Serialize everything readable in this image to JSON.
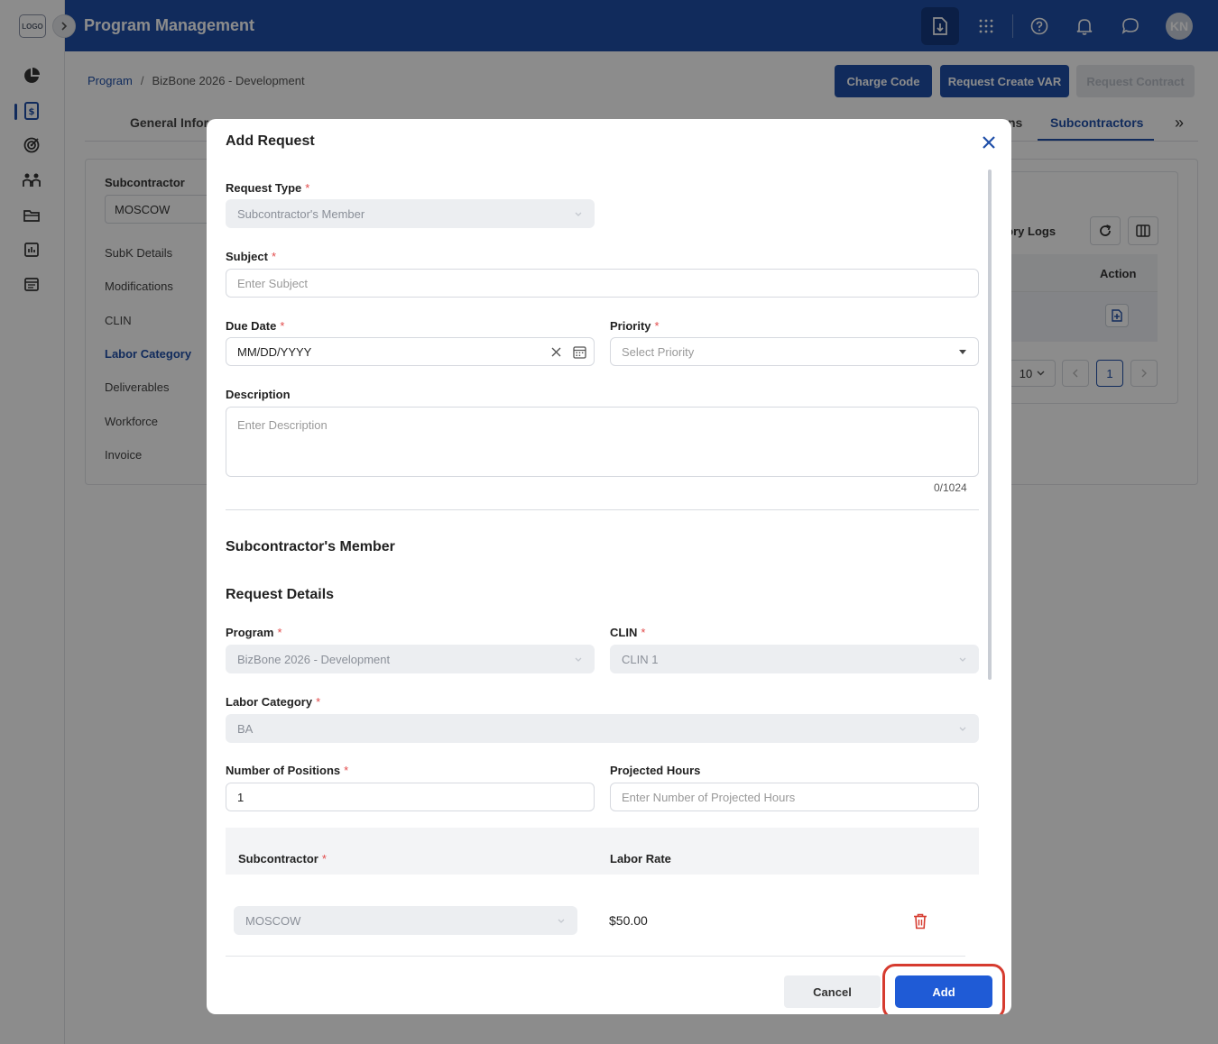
{
  "app": {
    "logo_text": "LOGO",
    "title": "Program Management",
    "avatar_initials": "KN"
  },
  "breadcrumb": {
    "root": "Program",
    "separator": "/",
    "current": "BizBone 2026 - Development"
  },
  "top_actions": {
    "charge_code": "Charge Code",
    "request_create_var": "Request Create VAR",
    "request_contract": "Request Contract"
  },
  "tabs": {
    "first": "General Infor",
    "partial": "ns",
    "active": "Subcontractors",
    "more": "»"
  },
  "side_panel": {
    "subcontractor_label": "Subcontractor",
    "subcontractor_value": "MOSCOW",
    "items": [
      "SubK Details",
      "Modifications",
      "CLIN",
      "Labor Category",
      "Deliverables",
      "Workforce",
      "Invoice"
    ],
    "active_item": "Labor Category"
  },
  "right_card": {
    "history_logs": "istory Logs",
    "action_header": "Action",
    "page_size": "10",
    "current_page": "1"
  },
  "modal": {
    "title": "Add Request",
    "request_type_label": "Request Type",
    "request_type_value": "Subcontractor's Member",
    "subject_label": "Subject",
    "subject_placeholder": "Enter Subject",
    "due_date_label": "Due Date",
    "due_date_value": "MM/DD/YYYY",
    "priority_label": "Priority",
    "priority_placeholder": "Select Priority",
    "description_label": "Description",
    "description_placeholder": "Enter Description",
    "description_counter": "0/1024",
    "section_member": "Subcontractor's Member",
    "section_details": "Request Details",
    "program_label": "Program",
    "program_value": "BizBone 2026 - Development",
    "clin_label": "CLIN",
    "clin_value": "CLIN 1",
    "labor_category_label": "Labor Category",
    "labor_category_value": "BA",
    "positions_label": "Number of Positions",
    "positions_value": "1",
    "projected_hours_label": "Projected Hours",
    "projected_hours_placeholder": "Enter Number of Projected Hours",
    "subcontractor_col": "Subcontractor",
    "labor_rate_col": "Labor Rate",
    "subcontractor_value": "MOSCOW",
    "labor_rate_value": "$50.00",
    "required_mark": "*",
    "cancel_label": "Cancel",
    "add_label": "Add"
  },
  "colors": {
    "brand": "#1f4fa8",
    "primary_button": "#1f5bd6",
    "highlight_ring": "#d63b2f",
    "required": "#e24b4b"
  }
}
